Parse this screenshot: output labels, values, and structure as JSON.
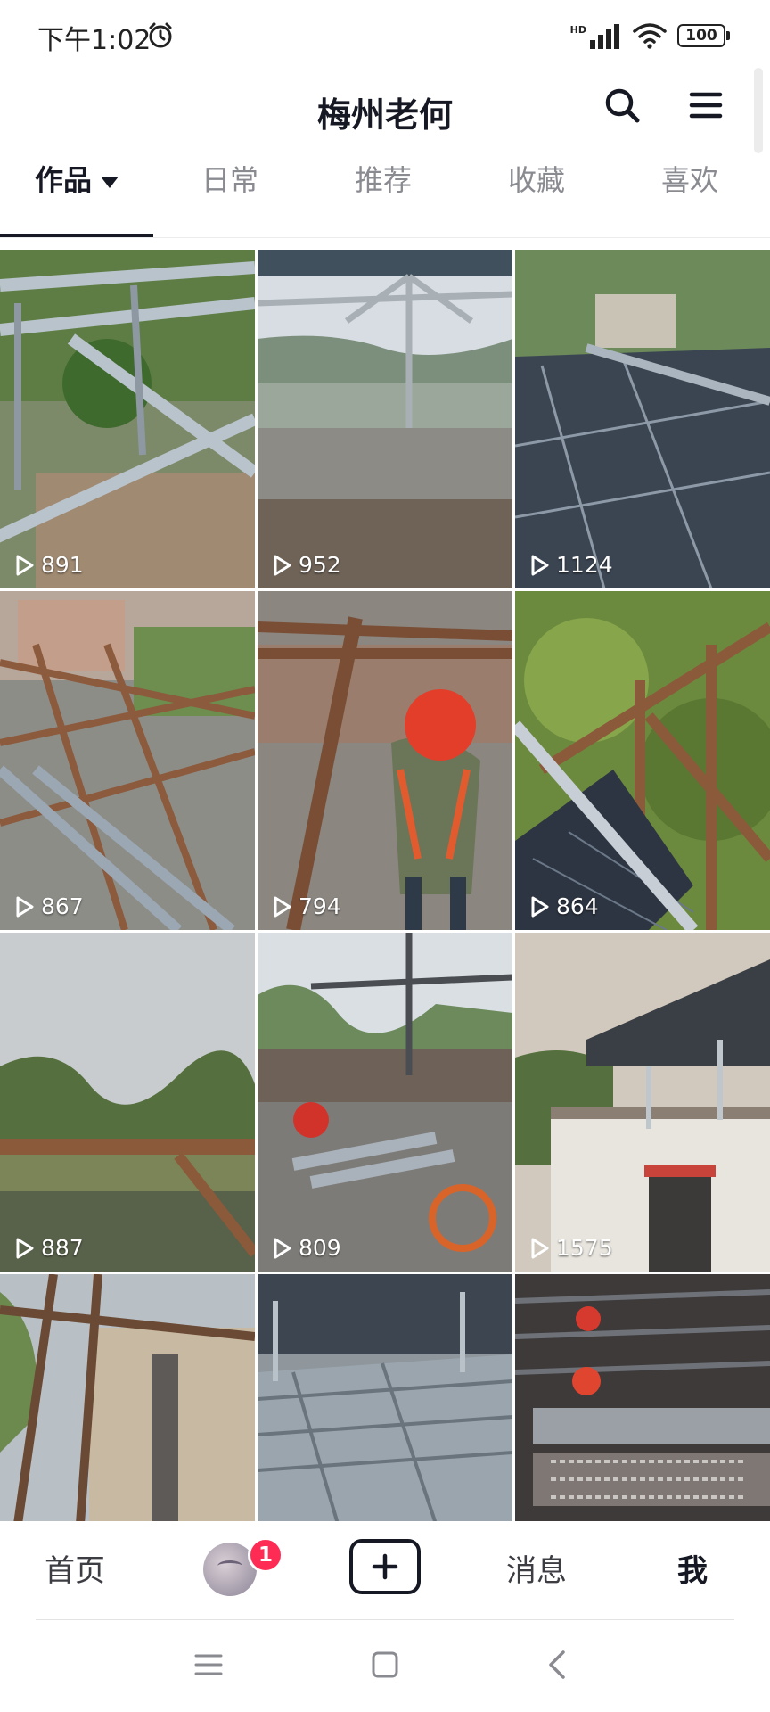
{
  "status_bar": {
    "time": "下午1:02",
    "hd": "HD",
    "battery": "100"
  },
  "header": {
    "title": "梅州老何"
  },
  "tabs": [
    {
      "label": "作品",
      "active": true
    },
    {
      "label": "日常",
      "active": false
    },
    {
      "label": "推荐",
      "active": false
    },
    {
      "label": "收藏",
      "active": false
    },
    {
      "label": "喜欢",
      "active": false
    }
  ],
  "videos": [
    {
      "plays": "891",
      "scene": "steel-frame-hillside"
    },
    {
      "plays": "952",
      "scene": "rooftop-village-view"
    },
    {
      "plays": "1124",
      "scene": "solar-panels-rooftop"
    },
    {
      "plays": "867",
      "scene": "brown-frame-structure"
    },
    {
      "plays": "794",
      "scene": "worker-red-helmet"
    },
    {
      "plays": "864",
      "scene": "frame-over-trees"
    },
    {
      "plays": "887",
      "scene": "river-landscape"
    },
    {
      "plays": "809",
      "scene": "rooftop-tools"
    },
    {
      "plays": "1575",
      "scene": "canopy-over-house"
    },
    {
      "plays": "",
      "scene": "frame-brick-wall"
    },
    {
      "plays": "",
      "scene": "metal-roof-rails"
    },
    {
      "plays": "",
      "scene": "under-panel-lanterns"
    }
  ],
  "bottom_nav": {
    "home": "首页",
    "badge": "1",
    "messages": "消息",
    "me": "我"
  },
  "colors": {
    "badge": "#fe2c55",
    "text_primary": "#161823",
    "tab_inactive": "#8a8b91"
  }
}
